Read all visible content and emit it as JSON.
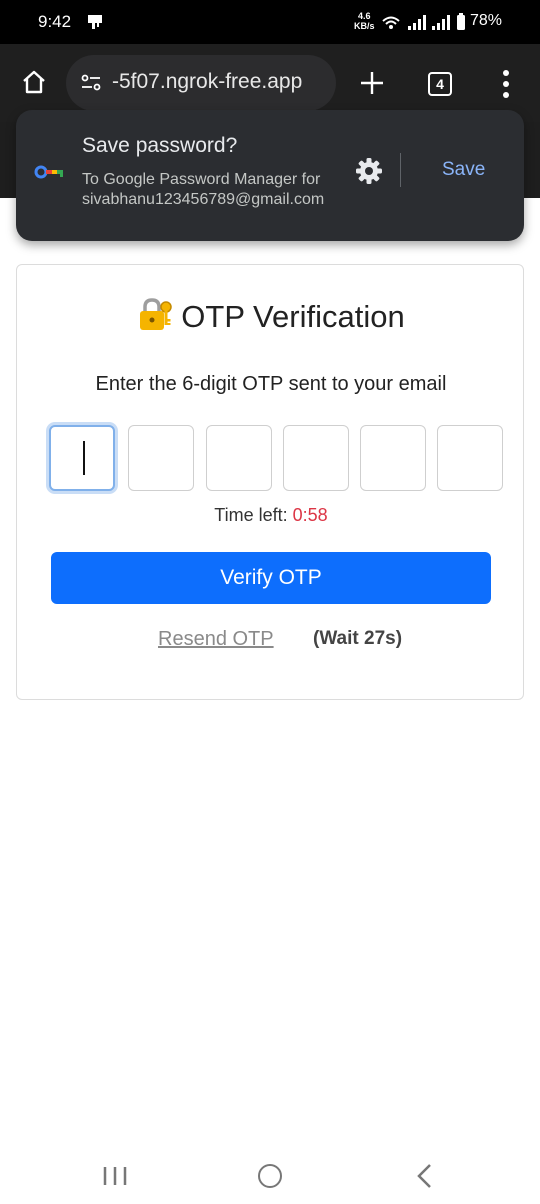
{
  "status_bar": {
    "time": "9:42",
    "net_speed_value": "4.6",
    "net_speed_unit": "KB/s",
    "battery": "78%"
  },
  "browser": {
    "url": "-5f07.ngrok-free.app",
    "tab_count": "4"
  },
  "password_popup": {
    "title": "Save password?",
    "subtitle_line1": "To Google Password Manager for",
    "subtitle_line2": "sivabhanu123456789@gmail.com",
    "save_label": "Save"
  },
  "otp": {
    "title": "OTP Verification",
    "instructions": "Enter the 6-digit OTP sent to your email",
    "digits": [
      "",
      "",
      "",
      "",
      "",
      ""
    ],
    "timer_label": "Time left:",
    "timer_value": "0:58",
    "verify_label": "Verify OTP",
    "resend_label": "Resend OTP",
    "wait_text": "(Wait 27s)"
  },
  "colors": {
    "accent": "#0d6efd",
    "timer": "#dc3545",
    "popup_bg": "#2b2d31",
    "popup_action": "#8ab4f8"
  },
  "icons": [
    "home-icon",
    "site-settings-icon",
    "new-tab-icon",
    "more-vert-icon",
    "key-icon",
    "gear-icon",
    "lock-with-key-icon"
  ]
}
